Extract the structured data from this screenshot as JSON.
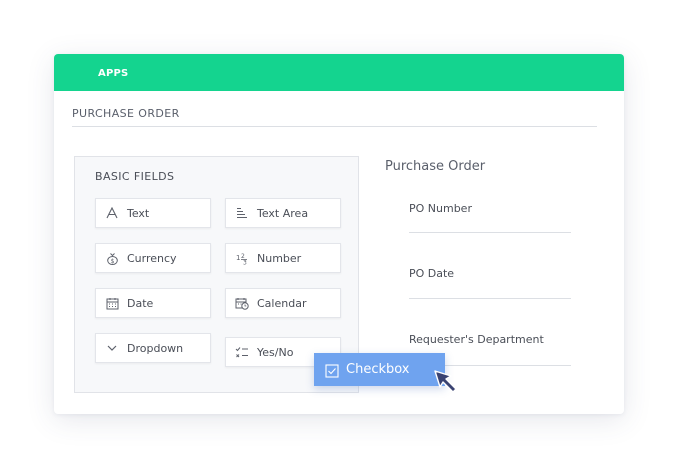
{
  "topbar": {
    "apps_label": "APPS"
  },
  "module": {
    "title": "PURCHASE ORDER"
  },
  "basic_fields": {
    "title": "BASIC FIELDS",
    "items": [
      {
        "label": "Text",
        "icon": "text-icon"
      },
      {
        "label": "Text Area",
        "icon": "text-area-icon"
      },
      {
        "label": "Currency",
        "icon": "currency-icon"
      },
      {
        "label": "Number",
        "icon": "number-icon"
      },
      {
        "label": "Date",
        "icon": "date-icon"
      },
      {
        "label": "Calendar",
        "icon": "calendar-icon"
      },
      {
        "label": "Dropdown",
        "icon": "chevron-down-icon"
      },
      {
        "label": "Yes/No",
        "icon": "yes-no-icon"
      }
    ]
  },
  "form": {
    "title": "Purchase Order",
    "fields": [
      {
        "label": "PO Number"
      },
      {
        "label": "PO Date"
      },
      {
        "label": "Requester's Department"
      }
    ]
  },
  "dragging": {
    "label": "Checkbox",
    "icon": "checkbox-icon"
  },
  "colors": {
    "topbar": "#14d48f",
    "drag_chip": "#6fa3ef",
    "cursor": "#3a4372"
  }
}
